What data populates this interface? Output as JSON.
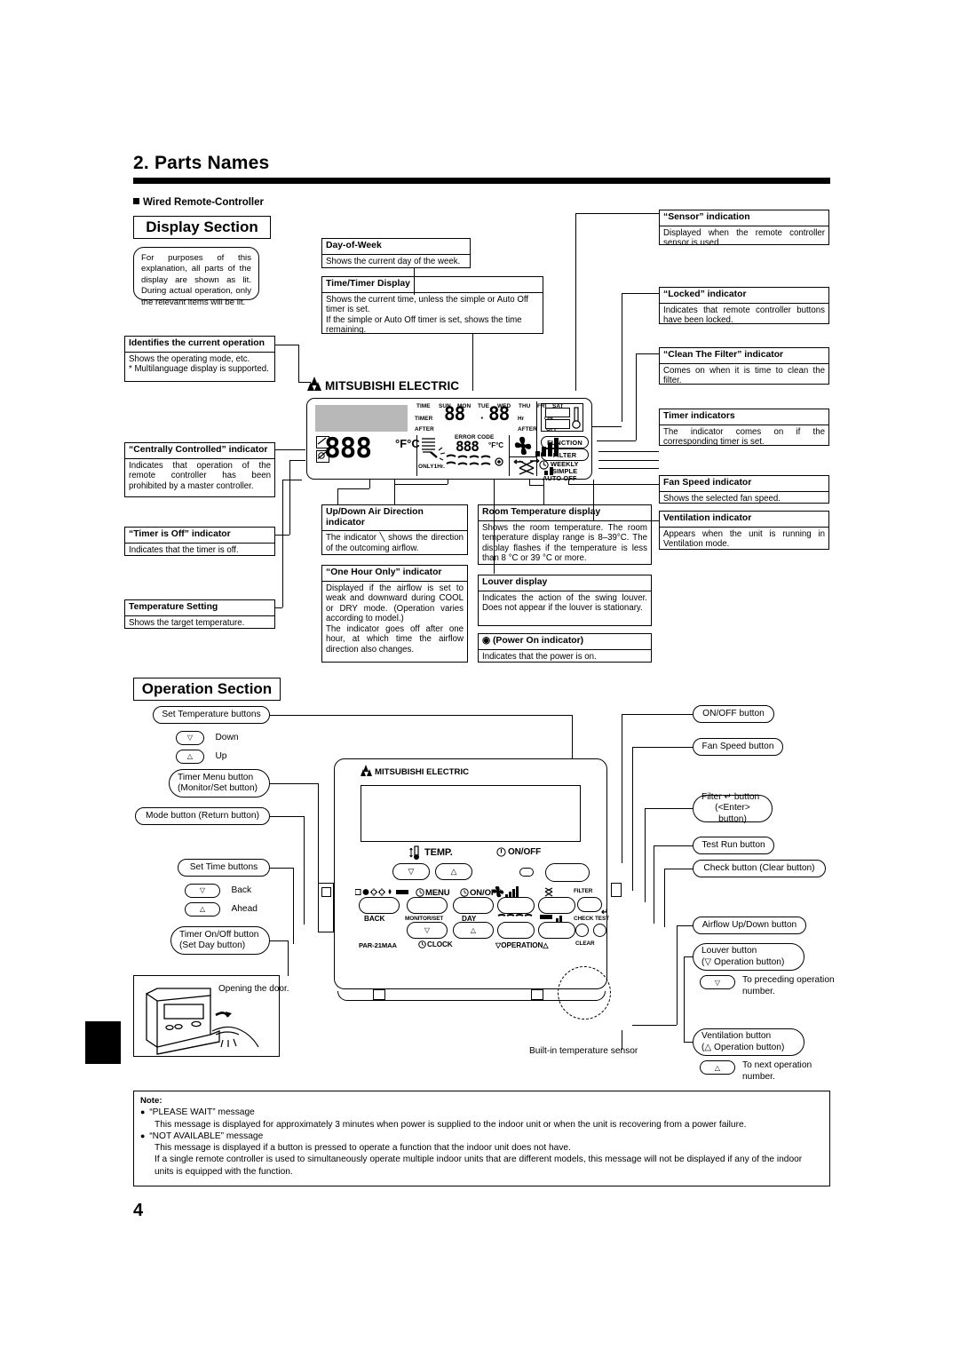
{
  "page": {
    "title": "2. Parts Names",
    "subheading": "Wired Remote-Controller",
    "number": "4"
  },
  "display_section": {
    "title": "Display Section",
    "note_bubble": "For purposes of this explanation, all parts of the display are shown as lit. During actual operation, only the relevant items will be lit.",
    "callouts_left": [
      {
        "id": "identifies-current-operation",
        "head": "Identifies the current operation",
        "body": "Shows the operating mode, etc.\n* Multilanguage display is supported."
      },
      {
        "id": "centrally-controlled-indicator",
        "head": "“Centrally Controlled” indicator",
        "body": "Indicates that operation of the remote controller has been prohibited by a master controller."
      },
      {
        "id": "timer-is-off-indicator",
        "head": "“Timer is Off” indicator",
        "body": "Indicates that the timer is off."
      },
      {
        "id": "temperature-setting",
        "head": "Temperature Setting",
        "body": "Shows the target temperature."
      }
    ],
    "callouts_top": [
      {
        "id": "day-of-week",
        "head": "Day-of-Week",
        "body": "Shows the current day of the week."
      },
      {
        "id": "time-timer-display",
        "head": "Time/Timer Display",
        "body": "Shows the current time, unless the simple or Auto Off timer is set.\nIf the simple or Auto Off timer is set, shows the time remaining."
      }
    ],
    "callouts_right": [
      {
        "id": "sensor-indication",
        "head": "“Sensor” indication",
        "body": "Displayed when the remote controller sensor is used."
      },
      {
        "id": "locked-indicator",
        "head": "“Locked” indicator",
        "body": "Indicates that remote controller buttons have been locked."
      },
      {
        "id": "clean-the-filter-indicator",
        "head": "“Clean The Filter” indicator",
        "body": "Comes on when it is time to clean the filter."
      },
      {
        "id": "timer-indicators",
        "head": "Timer indicators",
        "body": "The indicator comes on if the corresponding timer is set."
      },
      {
        "id": "fan-speed-indicator",
        "head": "Fan Speed indicator",
        "body": "Shows the selected fan speed."
      },
      {
        "id": "ventilation-indicator",
        "head": "Ventilation indicator",
        "body": "Appears when the unit is running in Ventilation mode."
      }
    ],
    "callouts_bottom": [
      {
        "id": "up-down-air-direction-indicator",
        "head": "Up/Down Air Direction indicator",
        "body": "The indicator ╲ shows the direction of the outcoming airflow."
      },
      {
        "id": "one-hour-only-indicator",
        "head": "“One Hour Only” indicator",
        "body": "Displayed if the airflow is set to weak and downward during COOL or DRY mode. (Operation varies according to model.)\nThe indicator goes off after one hour, at which time the airflow direction also changes."
      },
      {
        "id": "room-temperature-display",
        "head": "Room Temperature display",
        "body": "Shows the room temperature. The room temperature display range is 8–39°C. The display flashes if the temperature is less than 8 °C or 39 °C or more."
      },
      {
        "id": "louver-display",
        "head": "Louver display",
        "body": "Indicates the action of the swing louver. Does not appear if the louver is stationary."
      },
      {
        "id": "power-on-indicator",
        "head": "◉ (Power On indicator)",
        "body": "Indicates that the power is on."
      }
    ]
  },
  "lcd": {
    "brand": "MITSUBISHI ELECTRIC",
    "row_labels": [
      "TIME",
      "TIMER",
      "AFTER"
    ],
    "days": [
      "SUN",
      "MON",
      "TUE",
      "WED",
      "THU",
      "FRI",
      "SAT"
    ],
    "hr": "Hr",
    "on": "ON",
    "after": "AFTER",
    "off": "OFF",
    "error_code": "ERROR CODE",
    "time_left": "88",
    "time_sep": "·",
    "time_right": "88",
    "err_digits": "888",
    "err_unit": "°F°C",
    "temp_digits": "888",
    "temp_unit": "°F°C",
    "only_1hr": "ONLY1Hr.",
    "badges": [
      "FUNCTION",
      "FILTER"
    ],
    "timer_modes": [
      "WEEKLY",
      "SIMPLE",
      "AUTO OFF"
    ]
  },
  "operation_section": {
    "title": "Operation Section",
    "left_labels": [
      {
        "id": "set-temperature-buttons",
        "text": "Set Temperature buttons"
      },
      {
        "id": "timer-menu-button",
        "line1": "Timer Menu button",
        "line2": "(Monitor/Set button)"
      },
      {
        "id": "mode-button",
        "text": "Mode button (Return button)"
      },
      {
        "id": "set-time-buttons",
        "text": "Set Time buttons"
      },
      {
        "id": "timer-on-off-button",
        "line1": "Timer On/Off button",
        "line2": "(Set Day button)"
      }
    ],
    "left_keys": [
      {
        "id": "temp-down-key",
        "glyph": "▽",
        "label": "Down"
      },
      {
        "id": "temp-up-key",
        "glyph": "△",
        "label": "Up"
      },
      {
        "id": "time-back-key",
        "glyph": "▽",
        "label": "Back"
      },
      {
        "id": "time-ahead-key",
        "glyph": "△",
        "label": "Ahead"
      }
    ],
    "right_labels": [
      {
        "id": "on-off-button",
        "text": "ON/OFF button"
      },
      {
        "id": "fan-speed-button",
        "text": "Fan Speed button"
      },
      {
        "id": "filter-button",
        "line1": "Filter ↵ button",
        "line2": "(<Enter> button)"
      },
      {
        "id": "test-run-button",
        "text": "Test Run button"
      },
      {
        "id": "check-button",
        "text": "Check button (Clear button)"
      },
      {
        "id": "airflow-up-down-button",
        "text": "Airflow Up/Down button"
      },
      {
        "id": "louver-button",
        "line1": "Louver button",
        "line2": "(▽ Operation button)"
      },
      {
        "id": "ventilation-button",
        "line1": "Ventilation button",
        "line2": "(△ Operation button)"
      }
    ],
    "right_keys": [
      {
        "id": "preceding-operation-key",
        "glyph": "▽",
        "label": "To preceding operation number."
      },
      {
        "id": "next-operation-key",
        "glyph": "△",
        "label": "To next operation number."
      }
    ],
    "sensor_label": "Built-in temperature sensor",
    "door_label": "Opening the door."
  },
  "remote": {
    "brand": "MITSUBISHI ELECTRIC",
    "temp": "TEMP.",
    "on_off": "ON/OFF",
    "menu": "MENU",
    "menu_onoff": "ON/OFF",
    "back": "BACK",
    "monitor_set": "MONITOR/SET",
    "day": "DAY",
    "clock": "CLOCK",
    "operation": "OPERATION",
    "filter": "FILTER",
    "check": "CHECK",
    "test": "TEST",
    "clear": "CLEAR",
    "model": "PAR-21MAA",
    "down": "▽",
    "up": "△"
  },
  "note": {
    "title": "Note:",
    "items": [
      {
        "bullet": "“PLEASE WAIT” message",
        "lines": [
          "This message is displayed for approximately 3 minutes when power is supplied to the indoor unit or when the unit is recovering from a power failure."
        ]
      },
      {
        "bullet": "“NOT AVAILABLE” message",
        "lines": [
          "This message is displayed if a button is pressed to operate a function that the indoor unit does not have.",
          "If a single remote controller is used to simultaneously operate multiple indoor units that are different models, this message will not be displayed if any of the indoor units is equipped with the function."
        ]
      }
    ]
  }
}
